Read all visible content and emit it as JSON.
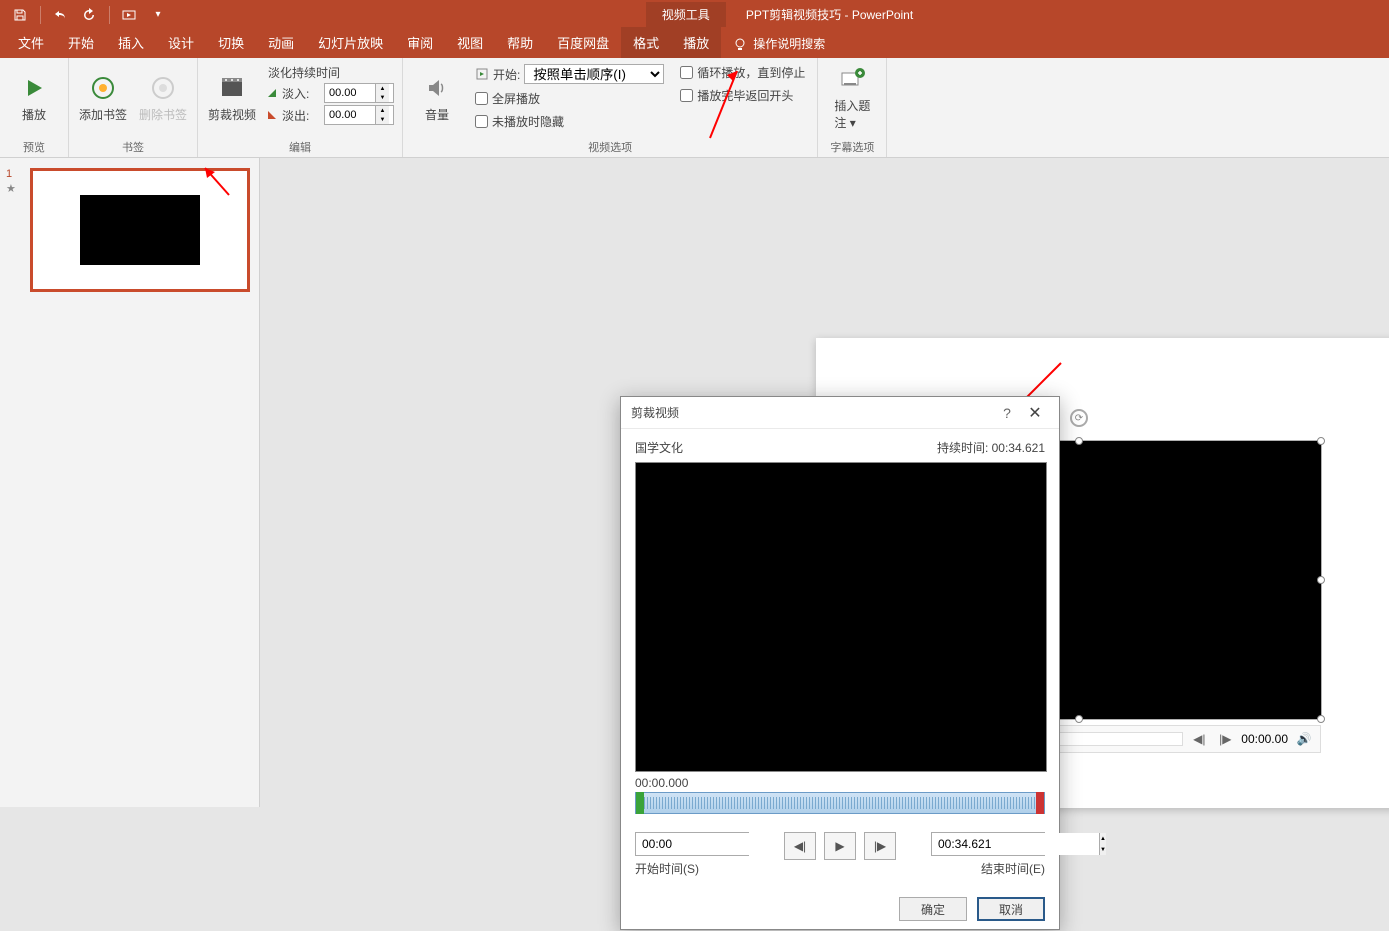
{
  "titlebar": {
    "context_tool": "视频工具",
    "doc_title": "PPT剪辑视频技巧  -  PowerPoint"
  },
  "tabs": {
    "file": "文件",
    "home": "开始",
    "insert": "插入",
    "design": "设计",
    "transitions": "切换",
    "animations": "动画",
    "slideshow": "幻灯片放映",
    "review": "审阅",
    "view": "视图",
    "help": "帮助",
    "baidu": "百度网盘",
    "format": "格式",
    "playback": "播放",
    "tellme": "操作说明搜索"
  },
  "ribbon": {
    "preview": {
      "play": "播放",
      "group": "预览"
    },
    "bookmark": {
      "add": "添加书签",
      "remove": "删除书签",
      "group": "书签"
    },
    "trim": {
      "label": "剪裁视频"
    },
    "edit": {
      "fade_title": "淡化持续时间",
      "fade_in": "淡入:",
      "fade_out": "淡出:",
      "fade_in_val": "00.00",
      "fade_out_val": "00.00",
      "group": "编辑"
    },
    "volume": "音量",
    "options": {
      "start_label": "开始:",
      "start_value": "按照单击顺序(I)",
      "fullscreen": "全屏播放",
      "hide": "未播放时隐藏",
      "loop": "循环播放，直到停止",
      "rewind": "播放完毕返回开头",
      "group": "视频选项"
    },
    "caption": {
      "label1": "插入题",
      "label2": "注",
      "group": "字幕选项"
    }
  },
  "slidepanel": {
    "num": "1",
    "star": "★"
  },
  "dialog": {
    "title": "剪裁视频",
    "video_name": "国学文化",
    "duration_label": "持续时间: 00:34.621",
    "current_time": "00:00.000",
    "start_val": "00:00",
    "end_val": "00:34.621",
    "start_label": "开始时间(S)",
    "end_label": "结束时间(E)",
    "ok": "确定",
    "cancel": "取消"
  },
  "video_player": {
    "time": "00:00.00"
  }
}
